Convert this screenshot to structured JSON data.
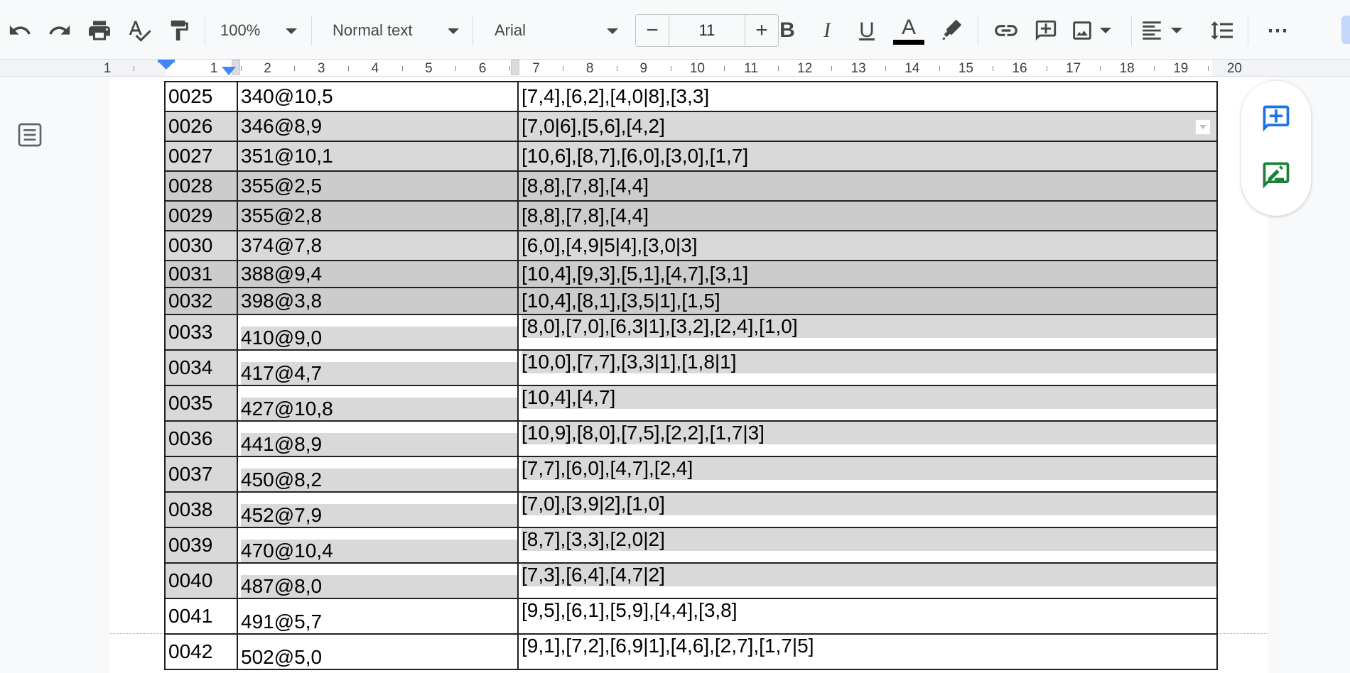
{
  "toolbar": {
    "zoom": "100%",
    "style": "Normal text",
    "font": "Arial",
    "font_size": "11",
    "minus": "−",
    "plus": "+",
    "bold": "B",
    "italic": "I",
    "underline": "U",
    "text_color_glyph": "A",
    "text_color": "#000000",
    "more": "⋯",
    "icons": [
      "undo-icon",
      "redo-icon",
      "print-icon",
      "spellcheck-icon",
      "paint-format-icon",
      "highlighter-icon",
      "link-icon",
      "add-comment-icon",
      "image-icon",
      "align-left-icon",
      "line-spacing-icon",
      "more-icon"
    ]
  },
  "ruler": {
    "labels": [
      "1",
      "1",
      "2",
      "3",
      "4",
      "5",
      "6",
      "7",
      "8",
      "9",
      "10",
      "11",
      "12",
      "13",
      "14",
      "15",
      "16",
      "17",
      "18",
      "19",
      "20"
    ]
  },
  "table": {
    "rows": [
      {
        "id": "0025",
        "value": "340@10,5",
        "seq": "[7,4],[6,2],[4,0|8],[3,3]"
      },
      {
        "id": "0026",
        "value": "346@8,9",
        "seq": "[7,0|6],[5,6],[4,2]"
      },
      {
        "id": "0027",
        "value": "351@10,1",
        "seq": "[10,6],[8,7],[6,0],[3,0],[1,7]"
      },
      {
        "id": "0028",
        "value": "355@2,5",
        "seq": "[8,8],[7,8],[4,4]"
      },
      {
        "id": "0029",
        "value": "355@2,8",
        "seq": "[8,8],[7,8],[4,4]"
      },
      {
        "id": "0030",
        "value": "374@7,8",
        "seq": "[6,0],[4,9|5|4],[3,0|3]"
      },
      {
        "id": "0031",
        "value": "388@9,4",
        "seq": "[10,4],[9,3],[5,1],[4,7],[3,1]"
      },
      {
        "id": "0032",
        "value": "398@3,8",
        "seq": "[10,4],[8,1],[3,5|1],[1,5]"
      },
      {
        "id": "0033",
        "value": "410@9,0",
        "seq": "[8,0],[7,0],[6,3|1],[3,2],[2,4],[1,0]"
      },
      {
        "id": "0034",
        "value": "417@4,7",
        "seq": "[10,0],[7,7],[3,3|1],[1,8|1]"
      },
      {
        "id": "0035",
        "value": "427@10,8",
        "seq": "[10,4],[4,7]"
      },
      {
        "id": "0036",
        "value": "441@8,9",
        "seq": "[10,9],[8,0],[7,5],[2,2],[1,7|3]"
      },
      {
        "id": "0037",
        "value": "450@8,2",
        "seq": "[7,7],[6,0],[4,7],[2,4]"
      },
      {
        "id": "0038",
        "value": "452@7,9",
        "seq": "[7,0],[3,9|2],[1,0]"
      },
      {
        "id": "0039",
        "value": "470@10,4",
        "seq": "[8,7],[3,3],[2,0|2]"
      },
      {
        "id": "0040",
        "value": "487@8,0",
        "seq": "[7,3],[6,4],[4,7|2]"
      },
      {
        "id": "0041",
        "value": "491@5,7",
        "seq": "[9,5],[6,1],[5,9],[4,4],[3,8]"
      },
      {
        "id": "0042",
        "value": "502@5,0",
        "seq": "[9,1],[7,2],[6,9|1],[4,6],[2,7],[1,7|5]"
      }
    ]
  },
  "side_actions": [
    "add-comment-icon",
    "suggest-edit-icon"
  ],
  "colors": {
    "accent": "#1a73e8",
    "suggest": "#188038",
    "cell_fill": "#d9d9d9",
    "cell_fill_dark": "#cccccc"
  }
}
